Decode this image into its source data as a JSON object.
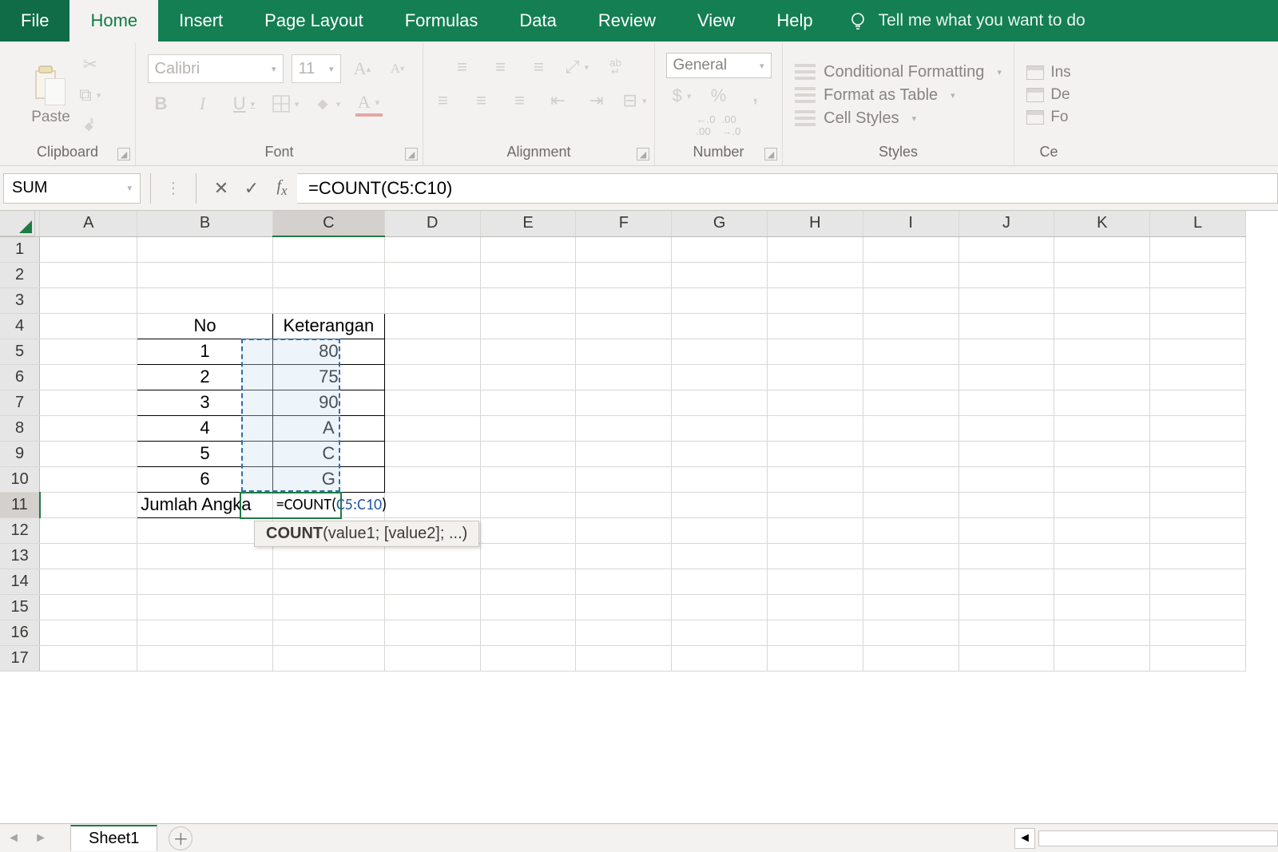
{
  "tabs": {
    "file": "File",
    "home": "Home",
    "insert": "Insert",
    "page_layout": "Page Layout",
    "formulas": "Formulas",
    "data": "Data",
    "review": "Review",
    "view": "View",
    "help": "Help",
    "tellme": "Tell me what you want to do"
  },
  "ribbon": {
    "clipboard": {
      "label": "Clipboard",
      "paste": "Paste"
    },
    "font": {
      "label": "Font",
      "name": "Calibri",
      "size": "11"
    },
    "alignment": {
      "label": "Alignment",
      "wrap": "ab"
    },
    "number": {
      "label": "Number",
      "format": "General",
      "inc_dec": "←.0  .00",
      "dec_inc": ".00  →.0"
    },
    "styles": {
      "label": "Styles",
      "cond": "Conditional Formatting",
      "table": "Format as Table",
      "cell": "Cell Styles"
    },
    "cells": {
      "label": "Ce",
      "ins": "Ins",
      "del": "De",
      "fmt": "Fo"
    }
  },
  "formula_bar": {
    "name_box": "SUM",
    "formula_prefix": "=COUNT(",
    "formula_ref": "C5:C10",
    "formula_suffix": ")"
  },
  "columns": [
    "A",
    "B",
    "C",
    "D",
    "E",
    "F",
    "G",
    "H",
    "I",
    "J",
    "K",
    "L"
  ],
  "rows": 17,
  "table": {
    "header_b": "No",
    "header_c": "Keterangan",
    "rows": [
      {
        "no": "1",
        "ket": "80"
      },
      {
        "no": "2",
        "ket": "75"
      },
      {
        "no": "3",
        "ket": "90"
      },
      {
        "no": "4",
        "ket": "A"
      },
      {
        "no": "5",
        "ket": "C"
      },
      {
        "no": "6",
        "ket": "G"
      }
    ],
    "total_label": "Jumlah Angka",
    "total_formula_prefix": "=COUNT(",
    "total_formula_ref": "C5:C10",
    "total_formula_suffix": ")"
  },
  "tooltip": {
    "name": "COUNT",
    "sig": "(value1; [value2]; ...)"
  },
  "sheet_tab": "Sheet1"
}
